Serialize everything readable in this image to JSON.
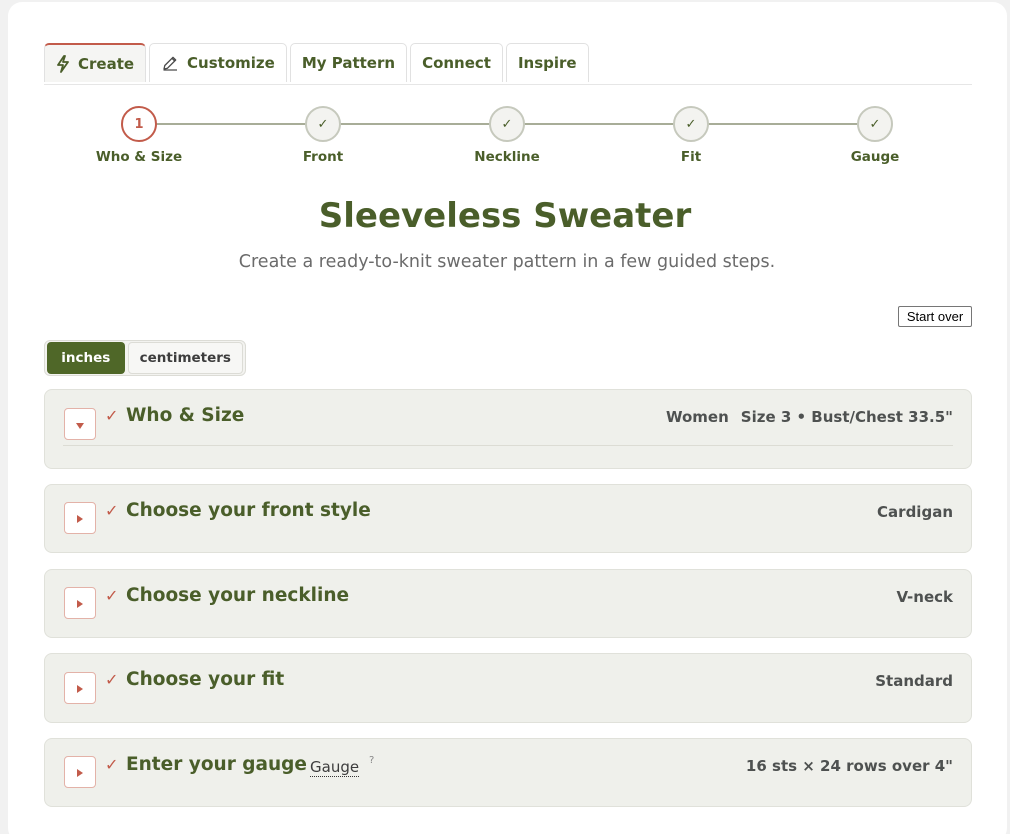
{
  "tabs": [
    {
      "label": "Create",
      "icon": "bolt-icon",
      "active": true
    },
    {
      "label": "Customize",
      "icon": "pencil-icon",
      "active": false
    },
    {
      "label": "My Pattern",
      "active": false
    },
    {
      "label": "Connect",
      "active": false
    },
    {
      "label": "Inspire",
      "active": false
    }
  ],
  "stepper": {
    "steps": [
      {
        "label": "Who & Size",
        "marker": "1",
        "state": "current"
      },
      {
        "label": "Front",
        "marker": "✓",
        "state": "done"
      },
      {
        "label": "Neckline",
        "marker": "✓",
        "state": "done"
      },
      {
        "label": "Fit",
        "marker": "✓",
        "state": "done"
      },
      {
        "label": "Gauge",
        "marker": "✓",
        "state": "done"
      }
    ]
  },
  "header": {
    "title": "Sleeveless Sweater",
    "subtitle": "Create a ready-to-knit sweater pattern in a few guided steps."
  },
  "actions": {
    "start_over": "Start over"
  },
  "units": {
    "options": [
      "inches",
      "centimeters"
    ],
    "selected": "inches"
  },
  "sections": [
    {
      "check": "✓",
      "title": "Who & Size",
      "summary_a": "Women",
      "summary_b": "Size 3 • Bust/Chest 33.5\"",
      "expanded": true
    },
    {
      "check": "✓",
      "title": "Choose your front style",
      "summary": "Cardigan",
      "expanded": false
    },
    {
      "check": "✓",
      "title": "Choose your neckline",
      "summary": "V-neck",
      "expanded": false
    },
    {
      "check": "✓",
      "title": "Choose your fit",
      "summary": "Standard",
      "expanded": false
    },
    {
      "check": "✓",
      "title": "Enter your gauge",
      "summary": "16 sts × 24 rows over 4\"",
      "help_label": "Gauge",
      "help_marker": "?",
      "expanded": false
    }
  ],
  "colors": {
    "brand_green": "#4a5e2a",
    "accent_red": "#c25b4a",
    "panel_bg": "#eff0eb"
  }
}
